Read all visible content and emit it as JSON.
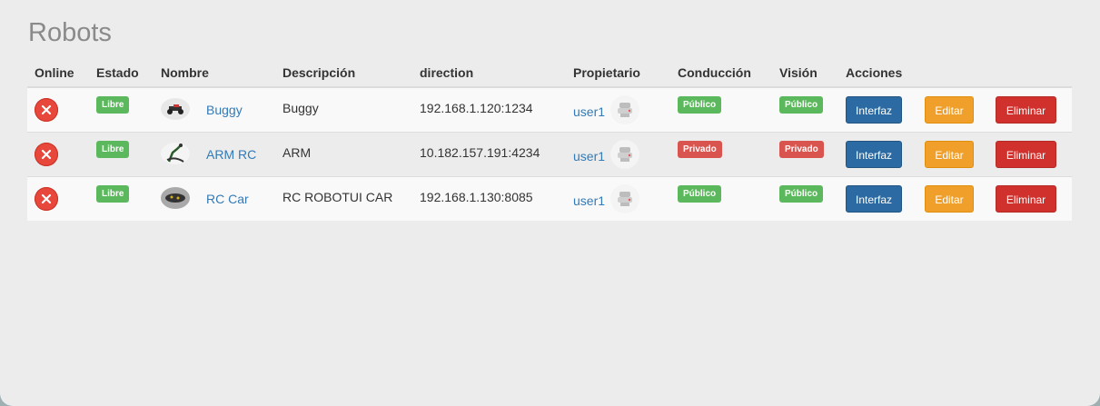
{
  "page": {
    "title": "Robots"
  },
  "table": {
    "headers": {
      "online": "Online",
      "estado": "Estado",
      "nombre": "Nombre",
      "descripcion": "Descripción",
      "direction": "direction",
      "propietario": "Propietario",
      "conduccion": "Conducción",
      "vision": "Visión",
      "acciones": "Acciones"
    },
    "rows": [
      {
        "estado": "Libre",
        "nombre": "Buggy",
        "descripcion": "Buggy",
        "direction": "192.168.1.120:1234",
        "propietario": "user1",
        "conduccion": "Público",
        "vision": "Público",
        "btn_interfaz": "Interfaz",
        "btn_editar": "Editar",
        "btn_eliminar": "Eliminar"
      },
      {
        "estado": "Libre",
        "nombre": "ARM RC",
        "descripcion": "ARM",
        "direction": "10.182.157.191:4234",
        "propietario": "user1",
        "conduccion": "Privado",
        "vision": "Privado",
        "btn_interfaz": "Interfaz",
        "btn_editar": "Editar",
        "btn_eliminar": "Eliminar"
      },
      {
        "estado": "Libre",
        "nombre": "RC Car",
        "descripcion": "RC ROBOTUI CAR",
        "direction": "192.168.1.130:8085",
        "propietario": "user1",
        "conduccion": "Público",
        "vision": "Público",
        "btn_interfaz": "Interfaz",
        "btn_editar": "Editar",
        "btn_eliminar": "Eliminar"
      }
    ]
  },
  "icons": {
    "offline": "close-circle-icon",
    "owner_avatar": "user-avatar-icon"
  },
  "colors": {
    "offline": "#e8473b",
    "label_success": "#5cb85c",
    "label_danger": "#d9534f",
    "btn_primary": "#2b6aa3",
    "btn_warning": "#f0a02a",
    "btn_danger": "#d0312d",
    "link": "#337ab7"
  }
}
